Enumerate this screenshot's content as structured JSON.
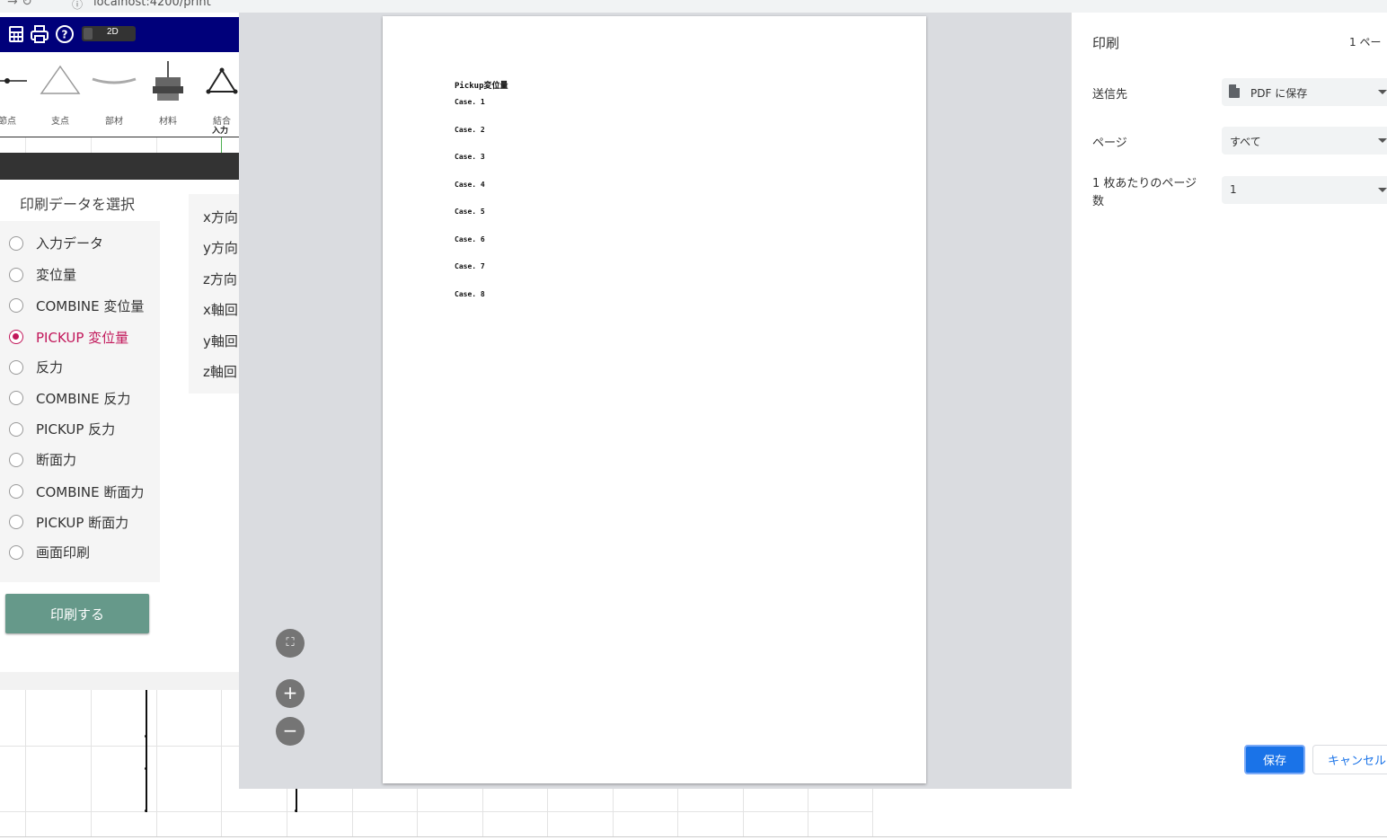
{
  "browser": {
    "url": "localhost:4200/print"
  },
  "toolbar": {
    "dimension_toggle": "2D",
    "icons": [
      "calculator-icon",
      "printer-icon",
      "help-icon"
    ]
  },
  "tools": [
    {
      "label": "節点",
      "icon": "node-icon"
    },
    {
      "label": "支点",
      "icon": "support-icon"
    },
    {
      "label": "部材",
      "icon": "member-icon"
    },
    {
      "label": "材料",
      "icon": "material-icon"
    },
    {
      "label": "結合",
      "icon": "joint-icon"
    }
  ],
  "active_tab": "入力",
  "print_panel": {
    "title": "印刷データを選択",
    "options": [
      {
        "label": "入力データ",
        "selected": false
      },
      {
        "label": "変位量",
        "selected": false
      },
      {
        "label": "COMBINE 変位量",
        "selected": false
      },
      {
        "label": "PICKUP 変位量",
        "selected": true
      },
      {
        "label": "反力",
        "selected": false
      },
      {
        "label": "COMBINE 反力",
        "selected": false
      },
      {
        "label": "PICKUP 反力",
        "selected": false
      },
      {
        "label": "断面力",
        "selected": false
      },
      {
        "label": "COMBINE 断面力",
        "selected": false
      },
      {
        "label": "PICKUP 断面力",
        "selected": false
      },
      {
        "label": "画面印刷",
        "selected": false
      }
    ],
    "print_button": "印刷する",
    "items": [
      "x方向",
      "y方向",
      "z方向",
      "x軸回",
      "y軸回",
      "z軸回"
    ]
  },
  "preview": {
    "title": "Pickup変位量",
    "cases": [
      "Case. 1",
      "Case. 2",
      "Case. 3",
      "Case. 4",
      "Case. 5",
      "Case. 6",
      "Case. 7",
      "Case. 8"
    ],
    "controls": [
      "fit-to-page-icon",
      "zoom-in-icon",
      "zoom-out-icon"
    ]
  },
  "print_settings": {
    "title": "印刷",
    "page_count": "1 ペー",
    "destination_label": "送信先",
    "destination_value": "PDF に保存",
    "pages_label": "ページ",
    "pages_value": "すべて",
    "pages_per_sheet_label_1": "1 枚あたりのページ",
    "pages_per_sheet_label_2": "数",
    "pages_per_sheet_value": "1",
    "save_button": "保存",
    "cancel_button": "キャンセル"
  }
}
